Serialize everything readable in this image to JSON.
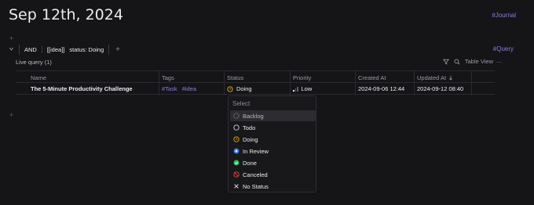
{
  "page": {
    "title": "Sep 12th, 2024",
    "tag": "#Journal",
    "bullet_glyph": "+"
  },
  "query": {
    "and_label": "AND",
    "term_1": "[[idea]]",
    "term_2": "status: Doing",
    "add_glyph": "+",
    "tag": "#Query",
    "live_label": "Live query (1)",
    "view_label": "Table View",
    "more_glyph": "…"
  },
  "table": {
    "columns": [
      "Name",
      "Tags",
      "Status",
      "Priority",
      "Created At",
      "Updated At"
    ],
    "rows": [
      {
        "name": "The 5-Minute Productivity Challenge",
        "tags": [
          "#Task",
          "#idea"
        ],
        "status": "Doing",
        "priority": "Low",
        "created_at": "2024-09-06 12:44",
        "updated_at": "2024-09-12 08:40"
      }
    ]
  },
  "status_menu": {
    "placeholder": "Select",
    "options": [
      "Backlog",
      "Todo",
      "Doing",
      "In Review",
      "Done",
      "Canceled",
      "No Status"
    ],
    "highlighted": "Backlog"
  },
  "colors": {
    "accent": "#8a7fd9",
    "doing": "#d4a017",
    "in_review": "#3b82f6",
    "done": "#22c55e",
    "canceled": "#ef4444"
  }
}
